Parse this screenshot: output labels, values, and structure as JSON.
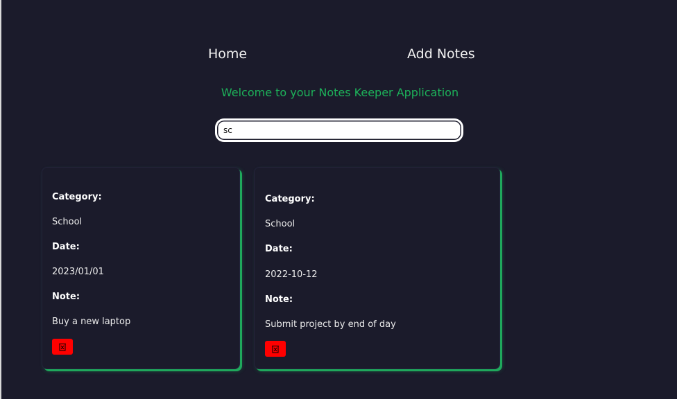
{
  "nav": {
    "home_label": "Home",
    "add_notes_label": "Add Notes"
  },
  "welcome": {
    "text": "Welcome to your Notes Keeper Application",
    "color": "#1db25a"
  },
  "search": {
    "value": "sc"
  },
  "notes": [
    {
      "category_label": "Category:",
      "category": "School",
      "date_label": "Date:",
      "date": "2023/01/01",
      "note_label": "Note:",
      "note": "Buy a new laptop",
      "delete_icon": "trash-icon"
    },
    {
      "category_label": "Category:",
      "category": "School",
      "date_label": "Date:",
      "date": "2022-10-12",
      "note_label": "Note:",
      "note": "Submit project by end of day",
      "delete_icon": "trash-icon"
    }
  ],
  "colors": {
    "background": "#1b1b2b",
    "accent": "#1fa85c",
    "delete": "#ff0000"
  }
}
